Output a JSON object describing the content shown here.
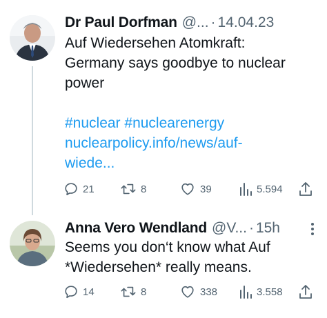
{
  "tweets": [
    {
      "name": "Dr Paul Dorfman",
      "handle": "@...",
      "time": "14.04.23",
      "text_lines": [
        "Auf Wiedersehen Atomkraft:",
        "Germany says goodbye to nuclear",
        "power"
      ],
      "hashtags": "#nuclear #nuclearenergy",
      "link_lines": [
        "nuclearpolicy.info/news/auf-",
        "wiede..."
      ],
      "replies": "21",
      "retweets": "8",
      "likes": "39",
      "views": "5.594",
      "avatar_icon": "profile-photo-man"
    },
    {
      "name": "Anna Vero Wendland",
      "handle": "@V...",
      "time": "15h",
      "text_lines": [
        "Seems you don‘t know what Auf",
        "*Wiedersehen* really means."
      ],
      "replies": "14",
      "retweets": "8",
      "likes": "338",
      "views": "3.558",
      "avatar_icon": "profile-photo-woman"
    }
  ],
  "separator": "·",
  "colors": {
    "text": "#0f1419",
    "secondary": "#536471",
    "link": "#1d9bf0",
    "thread_line": "#cfd9de"
  },
  "icons": {
    "reply": "reply-icon",
    "retweet": "retweet-icon",
    "like": "heart-icon",
    "views": "views-icon",
    "share": "share-icon",
    "more": "more-icon"
  }
}
